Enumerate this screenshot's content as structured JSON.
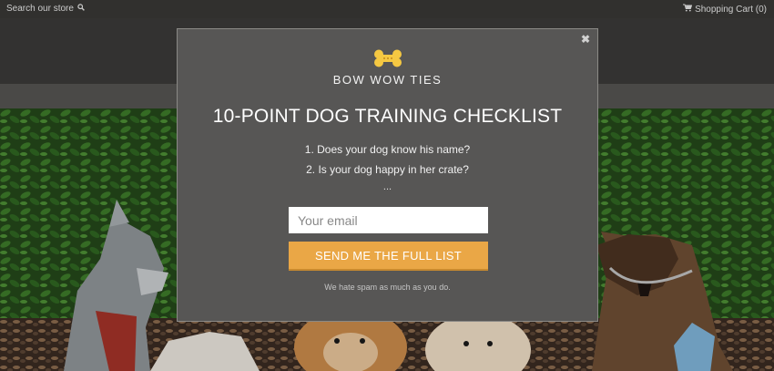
{
  "header": {
    "search_label": "Search our store",
    "search_icon": "search-icon",
    "cart_label": "Shopping Cart (0)",
    "cart_icon": "cart-icon"
  },
  "popup": {
    "close_glyph": "✖",
    "logo_icon": "bone-icon",
    "brand": "BOW WOW TIES",
    "headline": "10-POINT DOG TRAINING CHECKLIST",
    "items": [
      "1. Does your dog know his name?",
      "2. Is your dog happy in her crate?"
    ],
    "ellipsis": "...",
    "email_placeholder": "Your email",
    "submit_label": "SEND ME THE FULL LIST",
    "note": "We hate spam as much as you do."
  },
  "colors": {
    "accent": "#eaa746",
    "bone": "#f5c842",
    "modal_bg": "#575655"
  }
}
